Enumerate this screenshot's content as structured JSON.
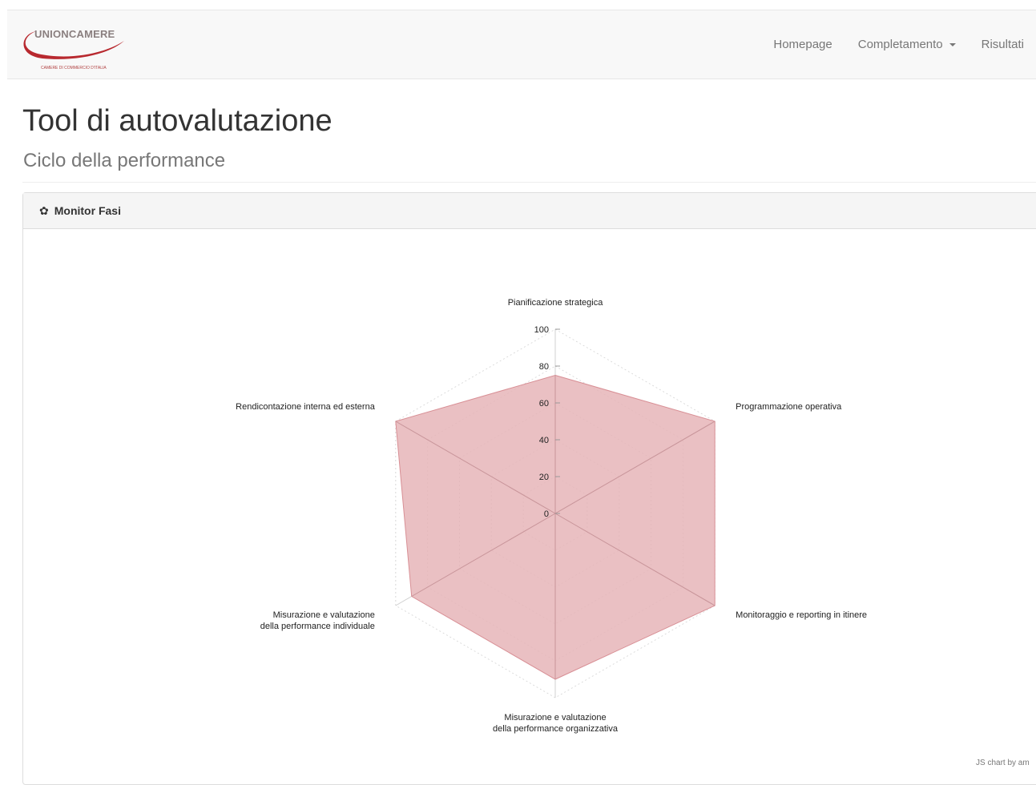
{
  "navbar": {
    "brand": "UNIONCAMERE",
    "brand_sub": "CAMERE DI COMMERCIO D'ITALIA",
    "links": [
      {
        "label": "Homepage"
      },
      {
        "label": "Completamento"
      },
      {
        "label": "Risultati"
      }
    ]
  },
  "header": {
    "title": "Tool di autovalutazione",
    "subtitle": "Ciclo della performance"
  },
  "panel": {
    "title": "Monitor Fasi",
    "icon": "gear-icon"
  },
  "chart_data": {
    "type": "radar",
    "axes": [
      [
        "Pianificazione strategica"
      ],
      [
        "Programmazione operativa"
      ],
      [
        "Monitoraggio e reporting in itinere"
      ],
      [
        "Misurazione e valutazione",
        "della performance organizzativa"
      ],
      [
        "Misurazione e valutazione",
        "della performance individuale"
      ],
      [
        "Rendicontazione interna ed esterna"
      ]
    ],
    "values": [
      75,
      100,
      100,
      90,
      90,
      100
    ],
    "rmin": 0,
    "rmax": 100,
    "ticks": [
      0,
      20,
      40,
      60,
      80,
      100
    ],
    "fill_color": "#e6b5b8",
    "stroke_color": "#d88f95"
  },
  "credit": "JS chart by am"
}
